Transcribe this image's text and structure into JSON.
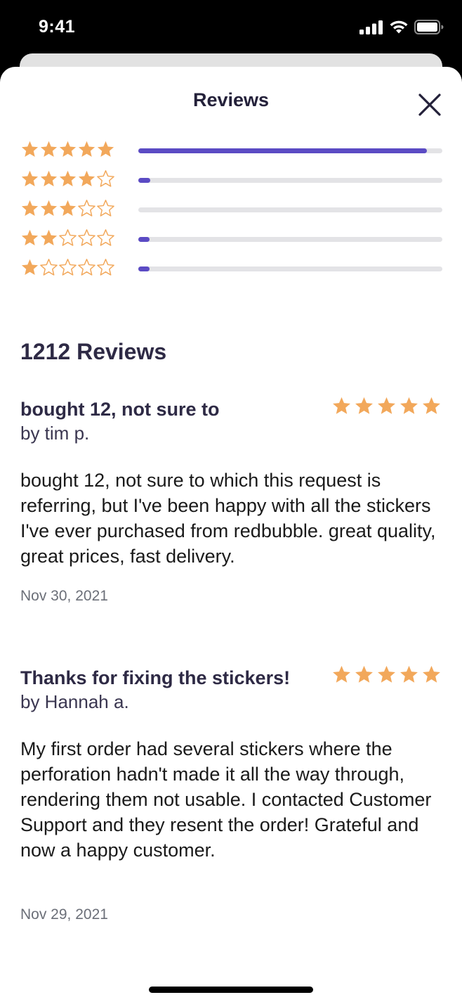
{
  "status_bar": {
    "time": "9:41"
  },
  "header": {
    "title": "Reviews"
  },
  "rating_breakdown": [
    {
      "stars": 5,
      "fraction": 0.95
    },
    {
      "stars": 4,
      "fraction": 0.04
    },
    {
      "stars": 3,
      "fraction": 0.0
    },
    {
      "stars": 2,
      "fraction": 0.03
    },
    {
      "stars": 1,
      "fraction": 0.03
    }
  ],
  "reviews_count_label": "1212 Reviews",
  "reviews": [
    {
      "title": "bought 12, not sure to",
      "author": "by tim p.",
      "rating": 5,
      "body": "bought 12, not sure to which this request is referring, but I've been happy with all the stickers I've ever purchased from redbubble. great quality, great prices, fast delivery.",
      "date": "Nov 30, 2021"
    },
    {
      "title": "Thanks for fixing the stickers!",
      "author": "by Hannah a.",
      "rating": 5,
      "body": "My first order had several stickers where the perforation hadn't made it all the way through, rendering them not usable. I contacted Customer Support and they resent the order! Grateful and now a happy customer.",
      "date": "Nov 29, 2021"
    }
  ],
  "colors": {
    "star": "#f2a85b",
    "bar_fill": "#5b4bc4",
    "bar_track": "#e3e3e6"
  }
}
